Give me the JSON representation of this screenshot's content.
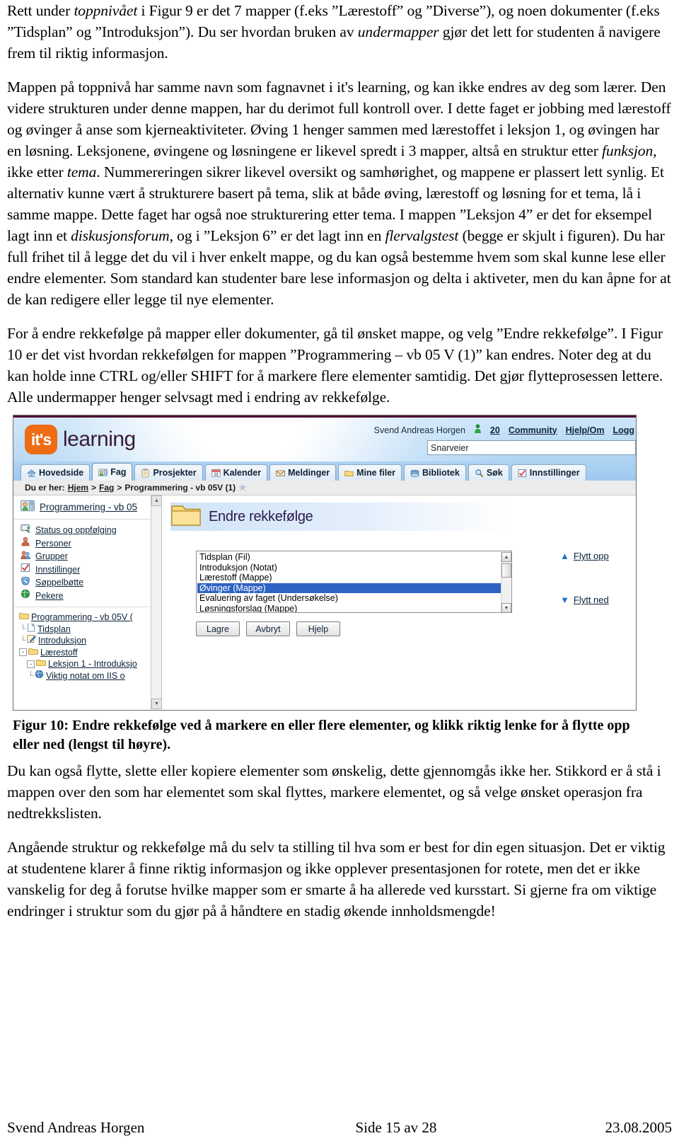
{
  "document": {
    "paragraphs": [
      "Rett under toppnivået i Figur 9 er det 7 mapper (f.eks ”Lærestoff” og ”Diverse”), og noen dokumenter (f.eks ”Tidsplan” og ”Introduksjon”). Du ser hvordan bruken av undermapper gjør det lett for studenten å navigere frem til riktig informasjon.",
      "Mappen på toppnivå har samme navn som fagnavnet i it's learning, og kan ikke endres av deg som lærer. Den videre strukturen under denne mappen, har du derimot full kontroll over. I dette faget er jobbing med lærestoff og øvinger å anse som kjerneaktiviteter. Øving 1 henger sammen med lærestoffet i leksjon 1, og øvingen har en løsning. Leksjonene, øvingene og løsningene er likevel spredt i 3 mapper, altså en struktur etter funksjon, ikke etter tema. Nummereringen sikrer likevel oversikt og samhørighet, og mappene er plassert lett synlig. Et alternativ kunne vært å strukturere basert på tema, slik at både øving, lærestoff og løsning for et tema, lå i samme mappe. Dette faget har også noe strukturering etter tema. I mappen ”Leksjon 4” er det for eksempel lagt inn et diskusjonsforum, og i ”Leksjon 6” er det lagt inn en flervalgstest (begge er skjult i figuren). Du har full frihet til å legge det du vil i hver enkelt mappe, og du kan også bestemme hvem som skal kunne lese eller endre elementer. Som standard kan studenter bare lese informasjon og delta i aktiveter, men du kan åpne for at de kan redigere eller legge til nye elementer.",
      "For å endre rekkefølge på mapper eller dokumenter, gå til ønsket mappe, og velg ”Endre rekkefølge”. I Figur 10 er det vist hvordan rekkefølgen for mappen ”Programmering – vb 05 V (1)” kan endres. Noter deg at du kan holde inne CTRL og/eller SHIFT for å markere flere elementer samtidig. Det gjør flytteprosessen lettere. Alle undermapper henger selvsagt med i endring av rekkefølge.",
      "Du kan også flytte, slette eller kopiere elementer som ønskelig, dette gjennomgås ikke her. Stikkord er å stå i mappen over den som har elementet som skal flyttes, markere elementet, og så velge ønsket operasjon fra nedtrekkslisten.",
      "Angående struktur og rekkefølge må du selv ta stilling til hva som er best for din egen situasjon. Det er viktig at studentene klarer å finne riktig informasjon og ikke opplever presentasjonen for rotete, men det er ikke vanskelig for deg å forutse hvilke mapper som er smarte å ha allerede ved kursstart. Si gjerne fra om viktige endringer i struktur som du gjør på å håndtere en stadig økende innholdsmengde!"
    ],
    "figure_caption": "Figur 10: Endre rekkefølge ved å markere en eller flere elementer, og klikk riktig lenke for å flytte opp eller ned (lengst til høyre).",
    "footer": {
      "author": "Svend Andreas Horgen",
      "page": "Side 15 av 28",
      "date": "23.08.2005"
    }
  },
  "screenshot": {
    "brand": {
      "badge": "it's",
      "word": "learning",
      "accent_color": "#ed6c15",
      "word_color": "#3a1b33"
    },
    "userbar": {
      "user_name": "Svend Andreas Horgen",
      "online_count": "20",
      "links": [
        "Community",
        "Hjelp/Om",
        "Logg"
      ]
    },
    "shortcuts": {
      "value": "Snarveier"
    },
    "tabs": [
      {
        "label": "Hovedside",
        "icon": "home-icon",
        "active": false
      },
      {
        "label": "Fag",
        "icon": "course-icon",
        "active": true
      },
      {
        "label": "Prosjekter",
        "icon": "clipboard-icon",
        "active": false
      },
      {
        "label": "Kalender",
        "icon": "calendar-icon",
        "active": false
      },
      {
        "label": "Meldinger",
        "icon": "mail-icon",
        "active": false
      },
      {
        "label": "Mine filer",
        "icon": "folder-icon",
        "active": false
      },
      {
        "label": "Bibliotek",
        "icon": "books-icon",
        "active": false
      },
      {
        "label": "Søk",
        "icon": "magnifier-icon",
        "active": false
      },
      {
        "label": "Innstillinger",
        "icon": "checklist-icon",
        "active": false
      }
    ],
    "breadcrumb": {
      "prefix": "Du er her:",
      "items": [
        "Hjem",
        "Fag",
        "Programmering - vb 05V (1)"
      ],
      "separator": ">",
      "favourite_icon": "star-icon"
    },
    "sidebar": {
      "course_title": "Programmering - vb 05",
      "links": [
        {
          "label": "Status og oppfølging",
          "icon": "status-icon"
        },
        {
          "label": "Personer",
          "icon": "person-icon"
        },
        {
          "label": "Grupper",
          "icon": "group-icon"
        },
        {
          "label": "Innstillinger",
          "icon": "checklist-icon"
        },
        {
          "label": "Søppelbøtte",
          "icon": "trash-icon"
        },
        {
          "label": "Pekere",
          "icon": "globe-icon"
        }
      ],
      "tree": [
        {
          "label": "Programmering - vb 05V (",
          "icon": "folder-open-icon",
          "depth": 0,
          "toggle": ""
        },
        {
          "label": "Tidsplan",
          "icon": "file-icon",
          "depth": 1,
          "toggle": ""
        },
        {
          "label": "Introduksjon",
          "icon": "note-icon",
          "depth": 1,
          "toggle": ""
        },
        {
          "label": "Lærestoff",
          "icon": "folder-icon",
          "depth": 1,
          "toggle": "-"
        },
        {
          "label": "Leksjon 1 - Introduksjo",
          "icon": "folder-icon",
          "depth": 2,
          "toggle": "-"
        },
        {
          "label": "Viktig notat om IIS o",
          "icon": "globe-icon",
          "depth": 3,
          "toggle": ""
        }
      ]
    },
    "dialog": {
      "title": "Endre rekkefølge",
      "title_icon": "folder-icon",
      "items": [
        {
          "label": "Tidsplan  (Fil)",
          "selected": false
        },
        {
          "label": "Introduksjon  (Notat)",
          "selected": false
        },
        {
          "label": "Lærestoff  (Mappe)",
          "selected": false
        },
        {
          "label": "Øvinger  (Mappe)",
          "selected": true
        },
        {
          "label": "Evaluering av faget  (Undersøkelse)",
          "selected": false
        },
        {
          "label": "Løsningsforslag  (Mappe)",
          "selected": false
        }
      ],
      "selection_color": "#2f63c4",
      "buttons": [
        "Lagre",
        "Avbryt",
        "Hjelp"
      ],
      "move_up": {
        "label": "Flytt opp",
        "icon": "chevron-up-icon"
      },
      "move_down": {
        "label": "Flytt ned",
        "icon": "chevron-down-icon"
      }
    }
  }
}
